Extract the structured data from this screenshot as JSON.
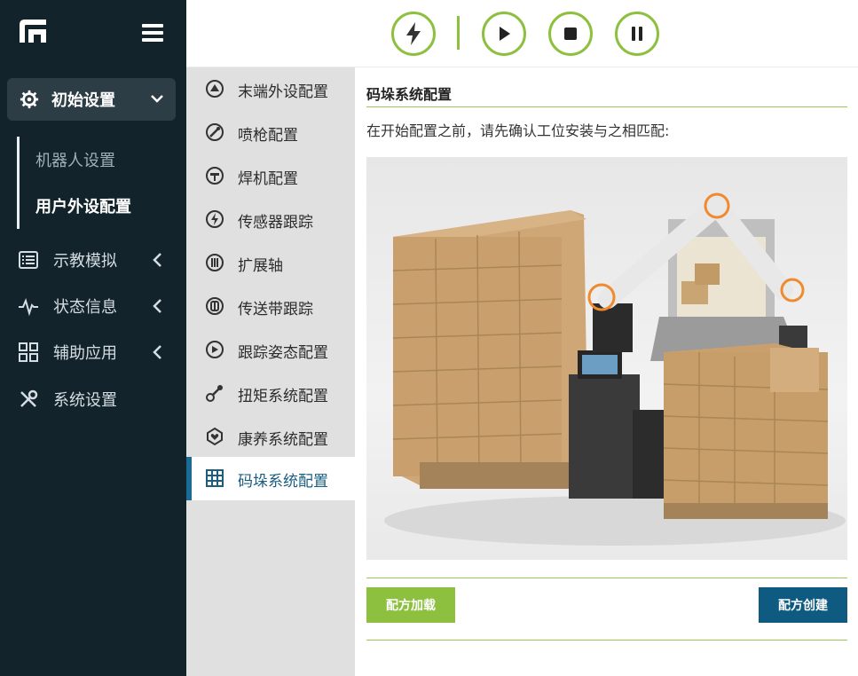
{
  "sidebar": {
    "group_active": {
      "label": "初始设置",
      "icon": "gear-icon"
    },
    "sub_items": [
      {
        "label": "机器人设置",
        "active": false
      },
      {
        "label": "用户外设配置",
        "active": true
      }
    ],
    "items": [
      {
        "label": "示教模拟",
        "icon": "list-icon"
      },
      {
        "label": "状态信息",
        "icon": "pulse-icon"
      },
      {
        "label": "辅助应用",
        "icon": "grid-icon"
      },
      {
        "label": "系统设置",
        "icon": "tools-icon"
      }
    ]
  },
  "toolbar": {
    "buttons": [
      "power-icon",
      "play-icon",
      "stop-icon",
      "pause-icon"
    ],
    "accent_color": "#8dc03f"
  },
  "menu": {
    "items": [
      {
        "label": "末端外设配置",
        "icon": "end-effector-icon"
      },
      {
        "label": "喷枪配置",
        "icon": "spray-gun-icon"
      },
      {
        "label": "焊机配置",
        "icon": "welder-icon"
      },
      {
        "label": "传感器跟踪",
        "icon": "sensor-icon"
      },
      {
        "label": "扩展轴",
        "icon": "axis-icon"
      },
      {
        "label": "传送带跟踪",
        "icon": "conveyor-icon"
      },
      {
        "label": "跟踪姿态配置",
        "icon": "tracking-pose-icon"
      },
      {
        "label": "扭矩系统配置",
        "icon": "torque-icon"
      },
      {
        "label": "康养系统配置",
        "icon": "healthcare-icon"
      },
      {
        "label": "码垛系统配置",
        "icon": "palletizing-icon",
        "active": true
      }
    ]
  },
  "content": {
    "title": "码垛系统配置",
    "description": "在开始配置之前，请先确认工位安装与之相匹配:",
    "load_button": "配方加载",
    "create_button": "配方创建"
  },
  "colors": {
    "sidebar_bg": "#13232b",
    "green": "#8dc03f",
    "blue": "#0f5a80",
    "active_bar": "#1a6b94"
  }
}
